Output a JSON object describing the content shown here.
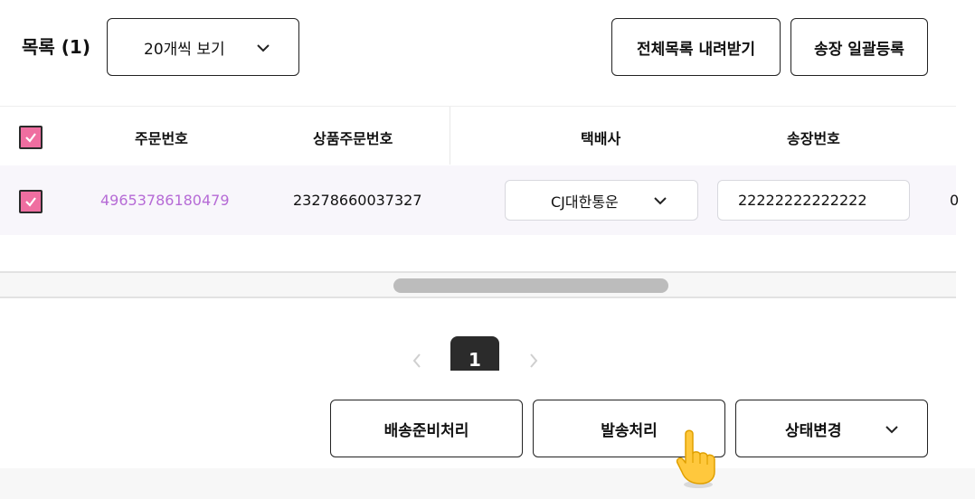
{
  "header": {
    "title": "목록 (1)",
    "page_size_label": "20개씩 보기",
    "download_all_label": "전체목록 내려받기",
    "bulk_invoice_label": "송장 일괄등록"
  },
  "table": {
    "columns": [
      "주문번호",
      "상품주문번호",
      "택배사",
      "송장번호"
    ],
    "rows": [
      {
        "checked": true,
        "order_number": "49653786180479",
        "product_order_number": "23278660037327",
        "courier": "CJ대한통운",
        "invoice_number": "22222222222222",
        "overflow_text": "0"
      }
    ]
  },
  "pagination": {
    "current_page": "1"
  },
  "actions": {
    "ready_shipping_label": "배송준비처리",
    "ship_label": "발송처리",
    "status_change_label": "상태변경"
  },
  "colors": {
    "accent": "#ef6ea0",
    "link": "#b66bd6",
    "row_bg": "#f8f6fb",
    "page_active": "#2b2b2b"
  }
}
